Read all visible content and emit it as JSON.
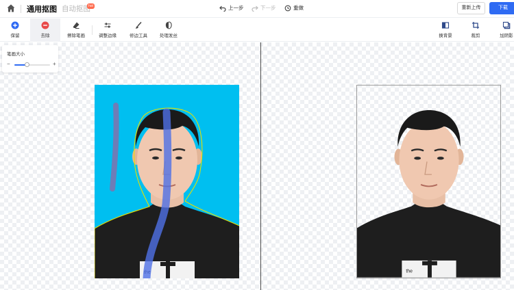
{
  "header": {
    "tab_active": "通用抠图",
    "tab_auto": "自动抠图",
    "hot_badge": "hot",
    "undo": "上一步",
    "redo": "下一步",
    "reset": "重做",
    "reupload": "重新上传",
    "download": "下载"
  },
  "toolbar": {
    "keep": "保留",
    "remove": "去除",
    "erase_brush": "擦除笔画",
    "adjust_edge": "调整边缘",
    "repair_tool": "修边工具",
    "process_hair": "处理发丝",
    "replace_bg": "换背景",
    "crop": "裁剪",
    "add_shadow": "加阴影"
  },
  "brush_panel": {
    "title": "笔画大小",
    "minus": "−",
    "plus": "+",
    "size_fraction": 0.35
  },
  "shirt_text": "the",
  "colors": {
    "accent": "#2f6bf3",
    "keep_icon": "#2f6bf3",
    "remove_icon": "#e84a4a",
    "photo_bg": "#00bff0",
    "edge_outline": "#e8e000"
  }
}
